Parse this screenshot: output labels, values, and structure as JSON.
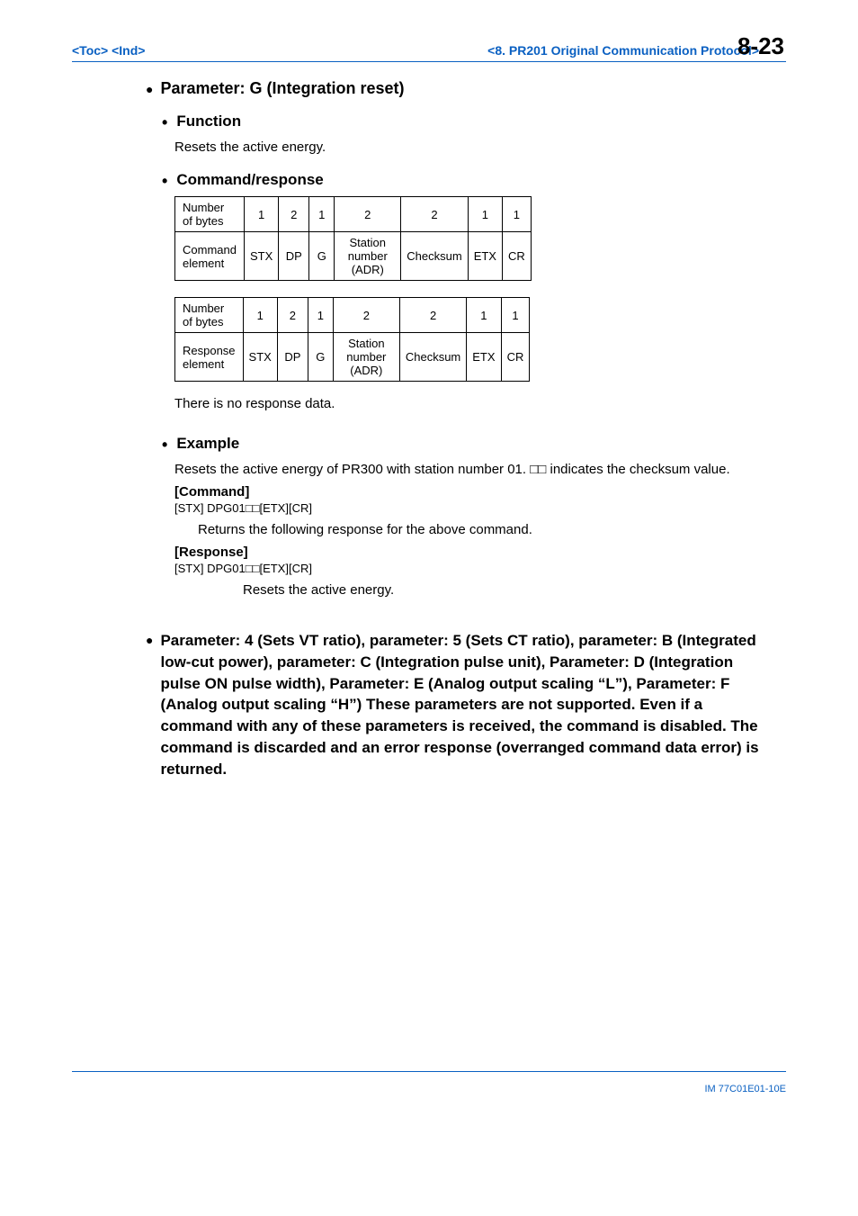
{
  "header": {
    "toc": "<Toc>",
    "ind": "<Ind>",
    "center": "<8.  PR201 Original Communication Protocol>",
    "page": "8-23"
  },
  "section": {
    "paramG": {
      "title": "Parameter: G (Integration reset)",
      "function": {
        "heading": "Function",
        "text": "Resets the active energy."
      },
      "cmdresp": {
        "heading": "Command/response"
      },
      "table1": {
        "row1label": "Number of bytes",
        "row1": [
          "1",
          "2",
          "1",
          "2",
          "2",
          "1",
          "1"
        ],
        "row2label": "Command element",
        "row2": [
          "STX",
          "DP",
          "G",
          "Station number (ADR)",
          "Checksum",
          "ETX",
          "CR"
        ]
      },
      "table2": {
        "row1label": "Number of bytes",
        "row1": [
          "1",
          "2",
          "1",
          "2",
          "2",
          "1",
          "1"
        ],
        "row2label": "Response element",
        "row2": [
          "STX",
          "DP",
          "G",
          "Station number (ADR)",
          "Checksum",
          "ETX",
          "CR"
        ]
      },
      "noresp": "There is no response data.",
      "example": {
        "heading": "Example",
        "intro": "Resets the active energy of PR300 with station number 01. □□ indicates the checksum value.",
        "cmdLabel": "[Command]",
        "cmdLine": "[STX] DPG01□□[ETX][CR]",
        "cmdReturns": "Returns the following response for the above command.",
        "respLabel": "[Response]",
        "respLine": "[STX] DPG01□□[ETX][CR]",
        "respDesc": "Resets the active energy."
      }
    },
    "unsupported": "Parameter: 4 (Sets VT ratio), parameter: 5 (Sets CT ratio), parameter: B (Integrated low-cut power), parameter: C (Integration pulse unit), Parameter: D (Integration pulse ON pulse width), Parameter: E (Analog output scaling “L”), Parameter: F (Analog output scaling “H”) These parameters are not supported. Even if a command with any of these parameters is received, the command is disabled. The command is discarded and an error response (overranged command data error) is returned."
  },
  "footer": {
    "id": "IM 77C01E01-10E"
  }
}
